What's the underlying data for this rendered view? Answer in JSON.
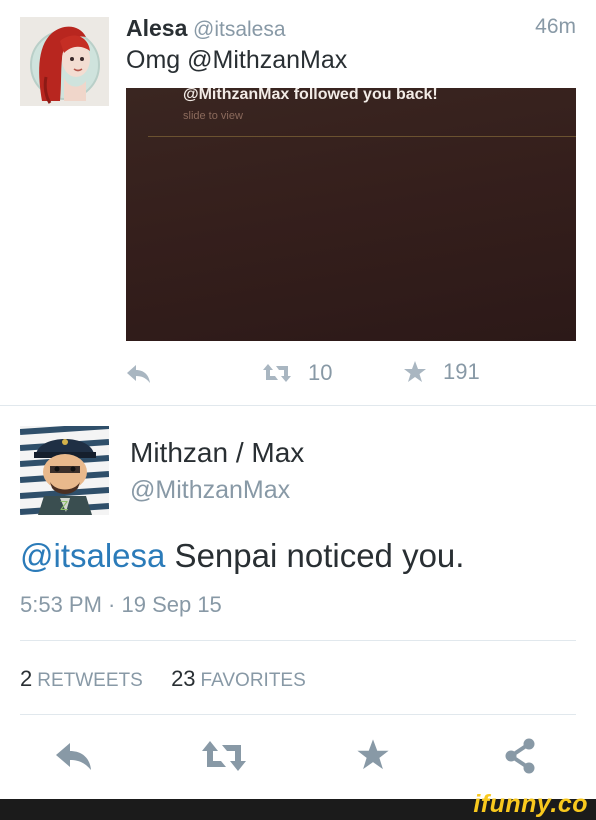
{
  "tweet1": {
    "display_name": "Alesa",
    "handle": "@itsalesa",
    "time": "46m",
    "text": "Omg @MithzanMax",
    "media": {
      "title": "@MithzanMax followed you back!",
      "subtitle": "slide to view"
    },
    "retweets": "10",
    "favorites": "191"
  },
  "tweet2": {
    "display_name": "Mithzan / Max",
    "handle": "@MithzanMax",
    "mention": "@itsalesa",
    "text": " Senpai noticed you.",
    "timestamp": "5:53 PM · 19 Sep 15",
    "retweet_count": "2",
    "retweet_label": "RETWEETS",
    "favorite_count": "23",
    "favorite_label": "FAVORITES"
  },
  "watermark": "ifunny.co",
  "colors": {
    "handle_gray": "#8899a6",
    "mention_blue": "#2b7bb9",
    "watermark_yellow": "#f9c91e"
  },
  "icons": [
    "reply-icon",
    "retweet-icon",
    "favorite-star-icon",
    "share-icon"
  ]
}
